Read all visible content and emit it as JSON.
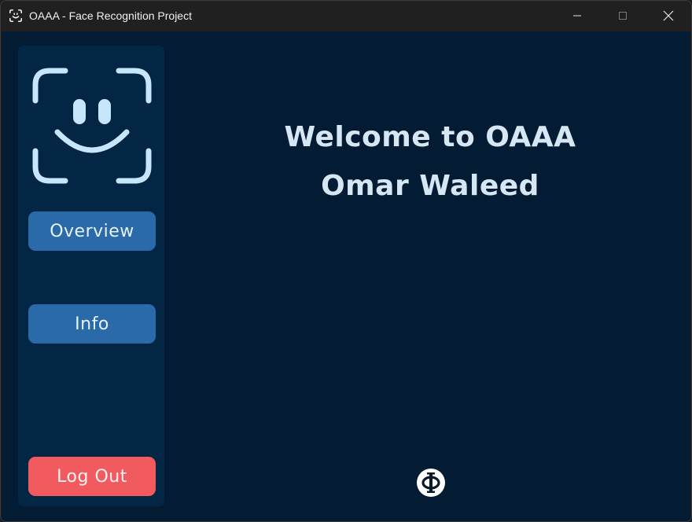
{
  "window": {
    "title": "OAAA - Face Recognition Project",
    "app_icon": "face-id-icon",
    "controls": [
      "minimize-icon",
      "maximize-icon",
      "close-icon"
    ]
  },
  "sidebar": {
    "logo_icon": "face-id-icon",
    "items": [
      {
        "label": "Overview"
      },
      {
        "label": "Info"
      }
    ],
    "logout_label": "Log Out"
  },
  "main": {
    "welcome_line1": "Welcome to OAAA",
    "welcome_line2": "Omar Waleed",
    "footer_icon": "phi-logo-icon"
  },
  "colors": {
    "background": "#031b33",
    "sidebar": "#032645",
    "nav_button": "#2a6aa9",
    "logout_button": "#f15a5e",
    "text": "#d7e6f3"
  }
}
